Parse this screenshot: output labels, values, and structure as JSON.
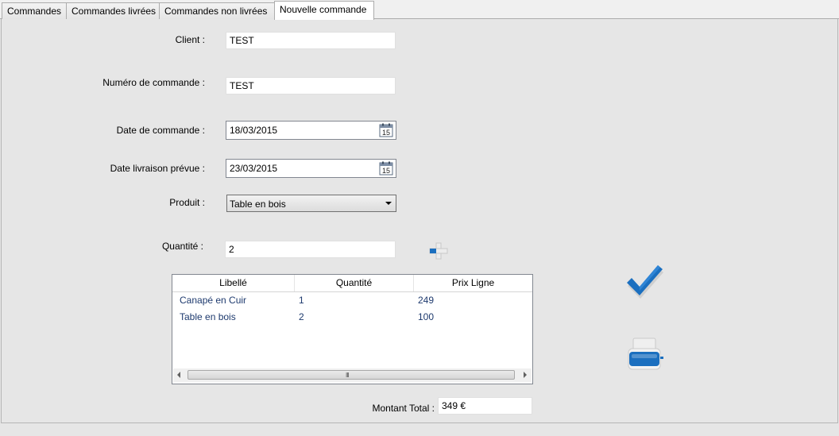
{
  "tabs": [
    {
      "label": "Commandes"
    },
    {
      "label": "Commandes livrées"
    },
    {
      "label": "Commandes non livrées"
    },
    {
      "label": "Nouvelle commande"
    }
  ],
  "form": {
    "client": {
      "label": "Client :",
      "value": "TEST"
    },
    "numero": {
      "label": "Numéro de commande :",
      "value": "TEST"
    },
    "date_commande": {
      "label": "Date de commande :",
      "value": "18/03/2015"
    },
    "date_livraison": {
      "label": "Date livraison prévue :",
      "value": "23/03/2015"
    },
    "produit": {
      "label": "Produit :",
      "value": "Table en bois"
    },
    "quantite": {
      "label": "Quantité :",
      "value": "2"
    }
  },
  "calendar_day": "15",
  "grid": {
    "columns": [
      "Libellé",
      "Quantité",
      "Prix Ligne"
    ],
    "rows": [
      [
        "Canapé en Cuir",
        "1",
        "249"
      ],
      [
        "Table en bois",
        "2",
        "100"
      ]
    ],
    "grip": "III"
  },
  "total": {
    "label": "Montant Total :",
    "value": "349 €"
  },
  "icons": {
    "add": "plus-icon",
    "validate": "checkmark-icon",
    "print": "printer-icon",
    "calendar": "calendar-icon"
  },
  "colors": {
    "accent": "#1b6fbf",
    "grid_text": "#1e3a6e"
  }
}
